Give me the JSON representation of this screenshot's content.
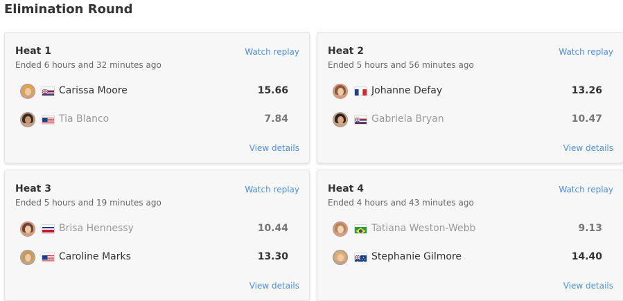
{
  "page": {
    "title": "Elimination Round"
  },
  "heats": [
    {
      "title": "Heat 1",
      "ended": "Ended 6 hours and 32 minutes ago",
      "watch_label": "Watch replay",
      "details_label": "View details",
      "surfers": [
        {
          "name": "Carissa Moore",
          "score": "15.66",
          "flag": "hawaii",
          "winner": true
        },
        {
          "name": "Tia Blanco",
          "score": "7.84",
          "flag": "usa",
          "winner": false
        }
      ]
    },
    {
      "title": "Heat 2",
      "ended": "Ended 5 hours and 56 minutes ago",
      "watch_label": "Watch replay",
      "details_label": "View details",
      "surfers": [
        {
          "name": "Johanne Defay",
          "score": "13.26",
          "flag": "france",
          "winner": true
        },
        {
          "name": "Gabriela Bryan",
          "score": "10.47",
          "flag": "hawaii",
          "winner": false
        }
      ]
    },
    {
      "title": "Heat 3",
      "ended": "Ended 5 hours and 19 minutes ago",
      "watch_label": "Watch replay",
      "details_label": "View details",
      "surfers": [
        {
          "name": "Brisa Hennessy",
          "score": "10.44",
          "flag": "costa-rica",
          "winner": false
        },
        {
          "name": "Caroline Marks",
          "score": "13.30",
          "flag": "usa",
          "winner": true
        }
      ]
    },
    {
      "title": "Heat 4",
      "ended": "Ended 4 hours and 43 minutes ago",
      "watch_label": "Watch replay",
      "details_label": "View details",
      "surfers": [
        {
          "name": "Tatiana Weston-Webb",
          "score": "9.13",
          "flag": "brazil",
          "winner": false
        },
        {
          "name": "Stephanie Gilmore",
          "score": "14.40",
          "flag": "australia",
          "winner": true
        }
      ]
    }
  ],
  "colors": {
    "link": "#4a90e2",
    "card_bg": "#f7f7f7",
    "winner_text": "#333333",
    "loser_text": "#999999"
  }
}
